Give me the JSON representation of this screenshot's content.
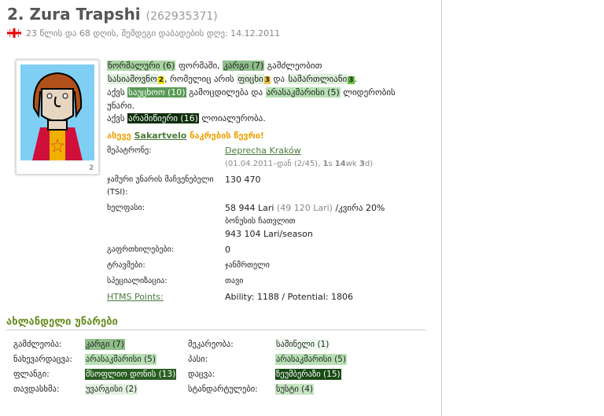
{
  "player": {
    "name": "2. Zura Trapshi",
    "id": "(262935371)",
    "age_line": "23 წლის და 68 დღის, შემდეგი დაბადების დღე: 14.12.2011",
    "flag_icon": "georgia-flag-icon",
    "shirt_number": "2"
  },
  "description": {
    "form": "ნორმალური (6)",
    "t1": " ფორმაში, ",
    "stamina": "კარგი (7)",
    "t2": " გამძლეობით",
    "agree": "სასიამოვნო",
    "agree_n": "2",
    "t3": ", რომელიც არის ",
    "aggr": "ფიცხი",
    "aggr_n": "3",
    "t4": " და ",
    "hon": "სამართლიანი",
    "hon_n": "3",
    "t5": ".",
    "t6": "აქვს ",
    "exp": "საუცხოო (10)",
    "t7": " გამოცდილება და ",
    "lead": "არასაკმარისი (5)",
    "t8": " ლიდერობის უნარი.",
    "t9": "აქვს ",
    "loy": "არამიწიერი (16)",
    "t10": " ლოიალურობა.",
    "nt1": "ასევე ",
    "nt_team": "Sakartvelo",
    "nt2": " ნაკრების წევრი!"
  },
  "info": {
    "owner_label": "მეპატრონე:",
    "owner": "Deprecha Kraków",
    "owner_since": "(01.04.2011–დან (2/45), ",
    "s": "1",
    "s_u": "s ",
    "wk": "14",
    "wk_u": "wk ",
    "d": "3",
    "d_u": "d)",
    "tsi_label": "ჯამური უნარის მაჩვენებელი (TSI):",
    "tsi": "130 470",
    "wage_label": "ხელფასი:",
    "wage": "58 944 Lari",
    "wage_base": " (49 120 Lari)",
    "wage_unit": " /კვირა 20%",
    "bonus": "ბონუსის ჩათვლით",
    "season": "943 104 Lari/season",
    "warn_label": "გაფრთხილებები:",
    "warn": "0",
    "inj_label": "ტრავმები:",
    "inj": "ჯანმრთელი",
    "spec_label": "სპეციალიზაცია:",
    "spec": "თავი",
    "htms_label": "HTMS Points:",
    "htms": "Ability: 1188 / Potential: 1806"
  },
  "skills_title": "ახლანდელი უნარები",
  "skills": [
    {
      "label": "გამძლეობა:",
      "value": "კარგი (7)",
      "color": "#8fbf8a"
    },
    {
      "label": "მეკარეობა:",
      "value": "საშინელი (1)",
      "color": "#eefaee"
    },
    {
      "label": "ნახევარდაცვა:",
      "value": "არასაკმარისი (5)",
      "color": "#b6e0b3"
    },
    {
      "label": "პასი:",
      "value": "არასაკმარისი (5)",
      "color": "#b6e0b3"
    },
    {
      "label": "ფლანგი:",
      "value": "მსოფლიო დონის (13)",
      "color": "#2a5e22"
    },
    {
      "label": "დაცვა:",
      "value": "ზეუმბერაზი (15)",
      "color": "#184a15"
    },
    {
      "label": "თავდასხმა:",
      "value": "უვარგისი (2)",
      "color": "#e2f2e0"
    },
    {
      "label": "სტანდარტულები:",
      "value": "სუსტი (4)",
      "color": "#c6e4c2"
    }
  ]
}
